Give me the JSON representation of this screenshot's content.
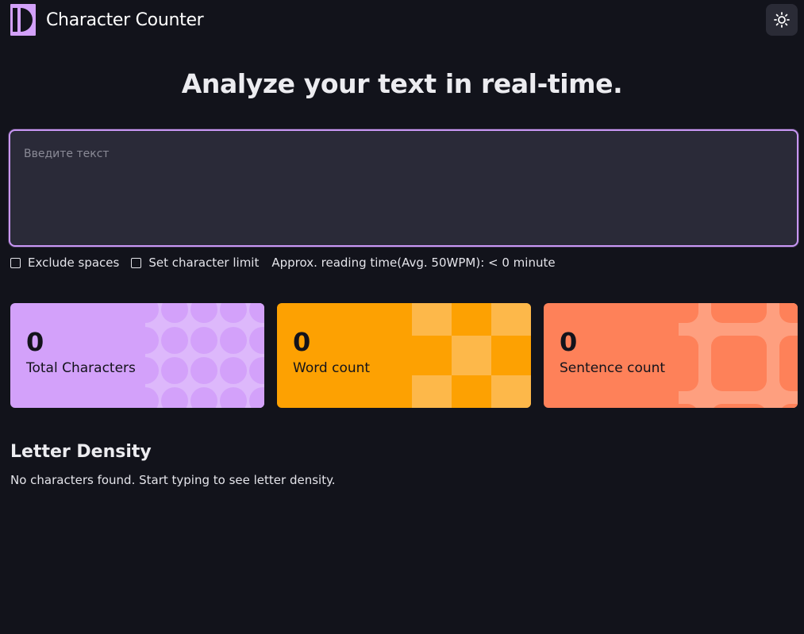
{
  "header": {
    "title": "Character Counter"
  },
  "theme_toggle": {
    "icon": "sun-icon"
  },
  "hero": {
    "headline": "Analyze your text in real-time."
  },
  "text_input": {
    "placeholder": "Введите текст",
    "value": ""
  },
  "options": {
    "exclude_spaces": {
      "label": "Exclude spaces",
      "checked": false
    },
    "character_limit": {
      "label": "Set character limit",
      "checked": false
    },
    "reading_time": "Approx. reading time(Avg. 50WPM): < 0 minute"
  },
  "stats": [
    {
      "value": "0",
      "label": "Total Characters",
      "color": "#d3a1fa"
    },
    {
      "value": "0",
      "label": "Word count",
      "color": "#fda102"
    },
    {
      "value": "0",
      "label": "Sentence count",
      "color": "#fe8159"
    }
  ],
  "density": {
    "title": "Letter Density",
    "empty_message": "No characters found. Start typing to see letter density."
  },
  "colors": {
    "background": "#12131b",
    "accent": "#c997f5",
    "input_bg": "#2a2a38"
  }
}
